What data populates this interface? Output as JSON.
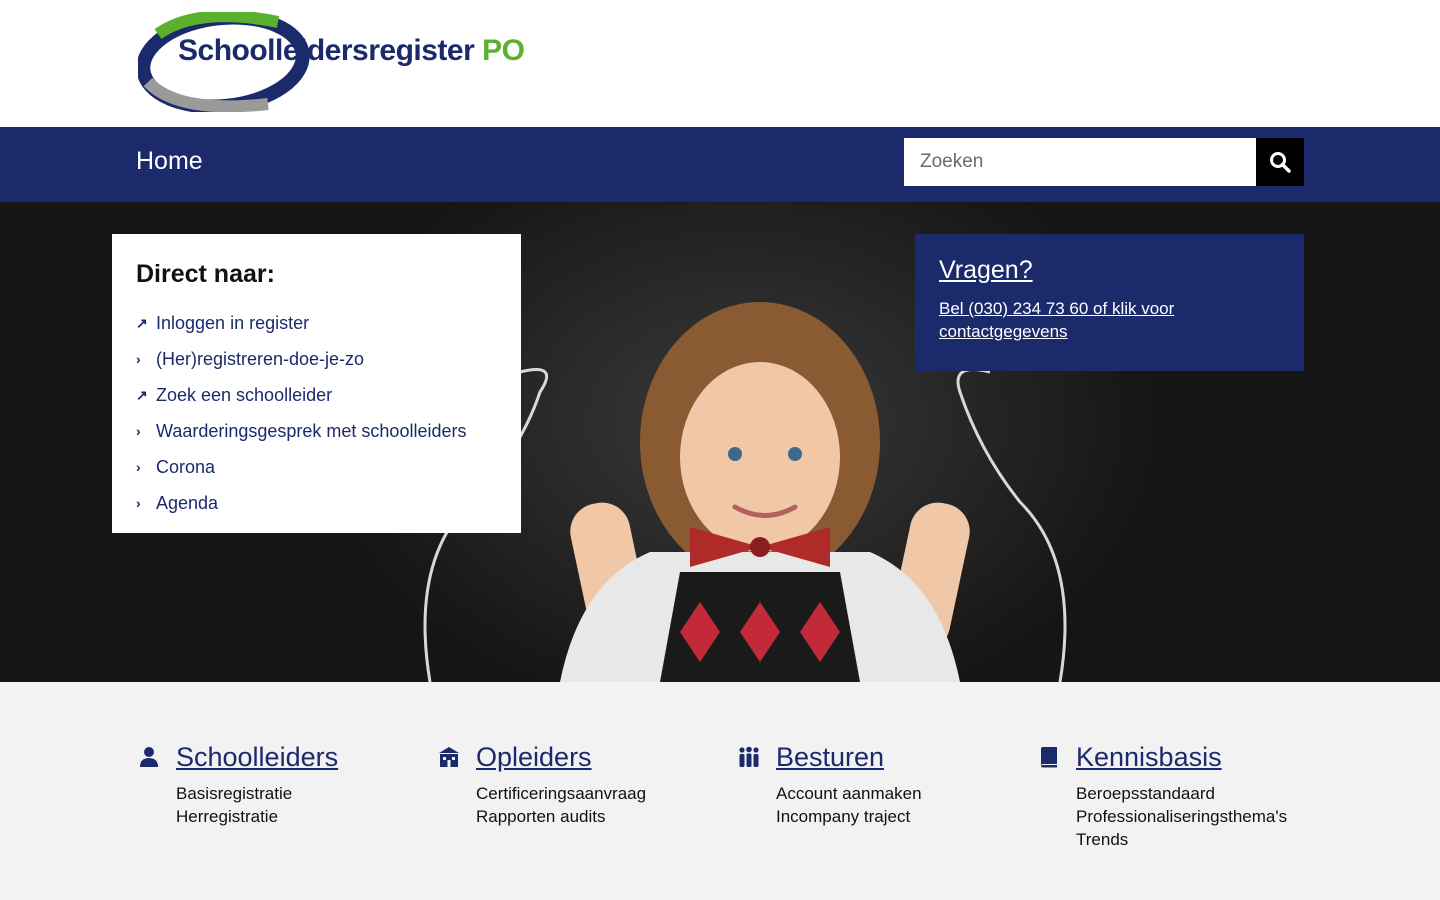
{
  "brand": {
    "name": "Schoolleidersregister",
    "suffix": "PO",
    "colors": {
      "navy": "#1b2a6b",
      "green": "#5bb030"
    }
  },
  "nav": {
    "home": "Home"
  },
  "search": {
    "placeholder": "Zoeken",
    "icon": "search-icon"
  },
  "direct": {
    "title": "Direct naar:",
    "items": [
      {
        "label": "Inloggen in register",
        "icon": "external-link-arrow-icon"
      },
      {
        "label": "(Her)registreren-doe-je-zo",
        "icon": "chevron-right-icon"
      },
      {
        "label": "Zoek een schoolleider",
        "icon": "external-link-arrow-icon"
      },
      {
        "label": "Waarderingsgesprek met schoolleiders",
        "icon": "chevron-right-icon"
      },
      {
        "label": "Corona",
        "icon": "chevron-right-icon"
      },
      {
        "label": "Agenda",
        "icon": "chevron-right-icon"
      }
    ]
  },
  "vragen": {
    "title": "Vragen?",
    "text": "Bel (030) 234 73 60 of klik voor contactgegevens"
  },
  "categories": [
    {
      "title": "Schoolleiders",
      "icon": "person-icon",
      "links": [
        "Basisregistratie",
        "Herregistratie"
      ]
    },
    {
      "title": "Opleiders",
      "icon": "school-building-icon",
      "links": [
        "Certificeringsaanvraag",
        "Rapporten audits"
      ]
    },
    {
      "title": "Besturen",
      "icon": "group-people-icon",
      "links": [
        "Account aanmaken",
        "Incompany traject"
      ]
    },
    {
      "title": "Kennisbasis",
      "icon": "book-icon",
      "links": [
        "Beroepsstandaard",
        "Professionaliseringsthema's",
        "Trends"
      ]
    }
  ]
}
